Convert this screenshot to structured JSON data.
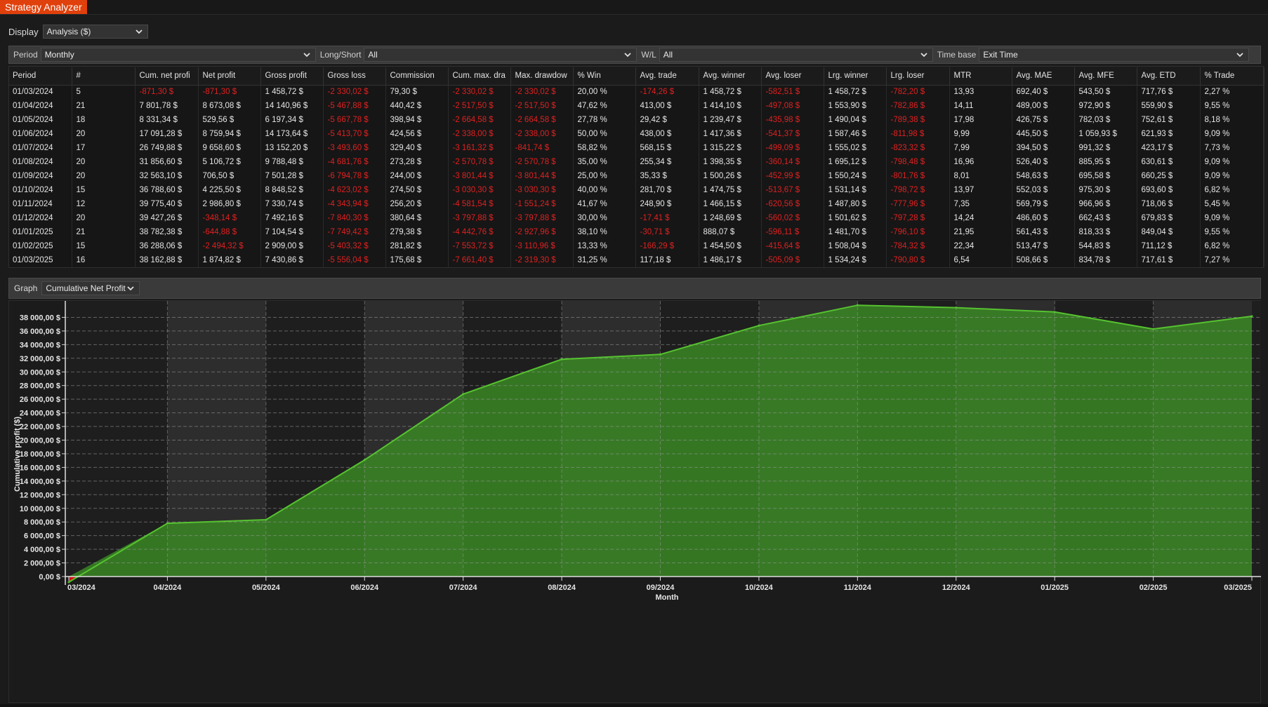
{
  "window": {
    "title": "Strategy Analyzer"
  },
  "display": {
    "label": "Display",
    "value": "Analysis ($)"
  },
  "filters": {
    "period": {
      "label": "Period",
      "value": "Monthly"
    },
    "longshort": {
      "label": "Long/Short",
      "value": "All"
    },
    "wl": {
      "label": "W/L",
      "value": "All"
    },
    "timebase": {
      "label": "Time base",
      "value": "Exit Time"
    }
  },
  "table": {
    "columns": [
      "Period",
      "#",
      "Cum. net profi",
      "Net profit",
      "Gross profit",
      "Gross loss",
      "Commission",
      "Cum. max. dra",
      "Max. drawdow",
      "% Win",
      "Avg. trade",
      "Avg. winner",
      "Avg. loser",
      "Lrg. winner",
      "Lrg. loser",
      "MTR",
      "Avg. MAE",
      "Avg. MFE",
      "Avg. ETD",
      "% Trade"
    ],
    "rows": [
      [
        "01/03/2024",
        "5",
        "-871,30 $",
        "-871,30 $",
        "1 458,72 $",
        "-2 330,02 $",
        "79,30 $",
        "-2 330,02 $",
        "-2 330,02 $",
        "20,00 %",
        "-174,26 $",
        "1 458,72 $",
        "-582,51 $",
        "1 458,72 $",
        "-782,20 $",
        "13,93",
        "692,40 $",
        "543,50 $",
        "717,76 $",
        "2,27 %"
      ],
      [
        "01/04/2024",
        "21",
        "7 801,78 $",
        "8 673,08 $",
        "14 140,96 $",
        "-5 467,88 $",
        "440,42 $",
        "-2 517,50 $",
        "-2 517,50 $",
        "47,62 %",
        "413,00 $",
        "1 414,10 $",
        "-497,08 $",
        "1 553,90 $",
        "-782,86 $",
        "14,11",
        "489,00 $",
        "972,90 $",
        "559,90 $",
        "9,55 %"
      ],
      [
        "01/05/2024",
        "18",
        "8 331,34 $",
        "529,56 $",
        "6 197,34 $",
        "-5 667,78 $",
        "398,94 $",
        "-2 664,58 $",
        "-2 664,58 $",
        "27,78 %",
        "29,42 $",
        "1 239,47 $",
        "-435,98 $",
        "1 490,04 $",
        "-789,38 $",
        "17,98",
        "426,75 $",
        "782,03 $",
        "752,61 $",
        "8,18 %"
      ],
      [
        "01/06/2024",
        "20",
        "17 091,28 $",
        "8 759,94 $",
        "14 173,64 $",
        "-5 413,70 $",
        "424,56 $",
        "-2 338,00 $",
        "-2 338,00 $",
        "50,00 %",
        "438,00 $",
        "1 417,36 $",
        "-541,37 $",
        "1 587,46 $",
        "-811,98 $",
        "9,99",
        "445,50 $",
        "1 059,93 $",
        "621,93 $",
        "9,09 %"
      ],
      [
        "01/07/2024",
        "17",
        "26 749,88 $",
        "9 658,60 $",
        "13 152,20 $",
        "-3 493,60 $",
        "329,40 $",
        "-3 161,32 $",
        "-841,74 $",
        "58,82 %",
        "568,15 $",
        "1 315,22 $",
        "-499,09 $",
        "1 555,02 $",
        "-823,32 $",
        "7,99",
        "394,50 $",
        "991,32 $",
        "423,17 $",
        "7,73 %"
      ],
      [
        "01/08/2024",
        "20",
        "31 856,60 $",
        "5 106,72 $",
        "9 788,48 $",
        "-4 681,76 $",
        "273,28 $",
        "-2 570,78 $",
        "-2 570,78 $",
        "35,00 %",
        "255,34 $",
        "1 398,35 $",
        "-360,14 $",
        "1 695,12 $",
        "-798,48 $",
        "16,96",
        "526,40 $",
        "885,95 $",
        "630,61 $",
        "9,09 %"
      ],
      [
        "01/09/2024",
        "20",
        "32 563,10 $",
        "706,50 $",
        "7 501,28 $",
        "-6 794,78 $",
        "244,00 $",
        "-3 801,44 $",
        "-3 801,44 $",
        "25,00 %",
        "35,33 $",
        "1 500,26 $",
        "-452,99 $",
        "1 550,24 $",
        "-801,76 $",
        "8,01",
        "548,63 $",
        "695,58 $",
        "660,25 $",
        "9,09 %"
      ],
      [
        "01/10/2024",
        "15",
        "36 788,60 $",
        "4 225,50 $",
        "8 848,52 $",
        "-4 623,02 $",
        "274,50 $",
        "-3 030,30 $",
        "-3 030,30 $",
        "40,00 %",
        "281,70 $",
        "1 474,75 $",
        "-513,67 $",
        "1 531,14 $",
        "-798,72 $",
        "13,97",
        "552,03 $",
        "975,30 $",
        "693,60 $",
        "6,82 %"
      ],
      [
        "01/11/2024",
        "12",
        "39 775,40 $",
        "2 986,80 $",
        "7 330,74 $",
        "-4 343,94 $",
        "256,20 $",
        "-4 581,54 $",
        "-1 551,24 $",
        "41,67 %",
        "248,90 $",
        "1 466,15 $",
        "-620,56 $",
        "1 487,80 $",
        "-777,96 $",
        "7,35",
        "569,79 $",
        "966,96 $",
        "718,06 $",
        "5,45 %"
      ],
      [
        "01/12/2024",
        "20",
        "39 427,26 $",
        "-348,14 $",
        "7 492,16 $",
        "-7 840,30 $",
        "380,64 $",
        "-3 797,88 $",
        "-3 797,88 $",
        "30,00 %",
        "-17,41 $",
        "1 248,69 $",
        "-560,02 $",
        "1 501,62 $",
        "-797,28 $",
        "14,24",
        "486,60 $",
        "662,43 $",
        "679,83 $",
        "9,09 %"
      ],
      [
        "01/01/2025",
        "21",
        "38 782,38 $",
        "-644,88 $",
        "7 104,54 $",
        "-7 749,42 $",
        "279,38 $",
        "-4 442,76 $",
        "-2 927,96 $",
        "38,10 %",
        "-30,71 $",
        "888,07 $",
        "-596,11 $",
        "1 481,70 $",
        "-796,10 $",
        "21,95",
        "561,43 $",
        "818,33 $",
        "849,04 $",
        "9,55 %"
      ],
      [
        "01/02/2025",
        "15",
        "36 288,06 $",
        "-2 494,32 $",
        "2 909,00 $",
        "-5 403,32 $",
        "281,82 $",
        "-7 553,72 $",
        "-3 110,96 $",
        "13,33 %",
        "-166,29 $",
        "1 454,50 $",
        "-415,64 $",
        "1 508,04 $",
        "-784,32 $",
        "22,34",
        "513,47 $",
        "544,83 $",
        "711,12 $",
        "6,82 %"
      ],
      [
        "01/03/2025",
        "16",
        "38 162,88 $",
        "1 874,82 $",
        "7 430,86 $",
        "-5 556,04 $",
        "175,68 $",
        "-7 661,40 $",
        "-2 319,30 $",
        "31,25 %",
        "117,18 $",
        "1 486,17 $",
        "-505,09 $",
        "1 534,24 $",
        "-790,80 $",
        "6,54",
        "508,66 $",
        "834,78 $",
        "717,61 $",
        "7,27 %"
      ]
    ]
  },
  "graph": {
    "label": "Graph",
    "value": "Cumulative Net Profit"
  },
  "chart_data": {
    "type": "area",
    "xlabel": "Month",
    "ylabel": "Cumulative profit ($)",
    "categories": [
      "03/2024",
      "04/2024",
      "05/2024",
      "06/2024",
      "07/2024",
      "08/2024",
      "09/2024",
      "10/2024",
      "11/2024",
      "12/2024",
      "01/2025",
      "02/2025",
      "03/2025"
    ],
    "series": [
      {
        "values": [
          -871.3,
          7801.78,
          8331.34,
          17091.28,
          26749.88,
          31856.6,
          32563.1,
          36788.6,
          39775.4,
          39427.26,
          38782.38,
          36288.06,
          38162.88
        ]
      }
    ],
    "yticks": [
      "0,00 $",
      "2 000,00 $",
      "4 000,00 $",
      "6 000,00 $",
      "8 000,00 $",
      "10 000,00 $",
      "12 000,00 $",
      "14 000,00 $",
      "16 000,00 $",
      "18 000,00 $",
      "20 000,00 $",
      "22 000,00 $",
      "24 000,00 $",
      "26 000,00 $",
      "28 000,00 $",
      "30 000,00 $",
      "32 000,00 $",
      "34 000,00 $",
      "36 000,00 $",
      "38 000,00 $"
    ],
    "ylim": [
      0,
      40000
    ],
    "grid": true,
    "fill_color": "#3b8a24",
    "line_color": "#56c230",
    "negative_color": "#d01010"
  }
}
